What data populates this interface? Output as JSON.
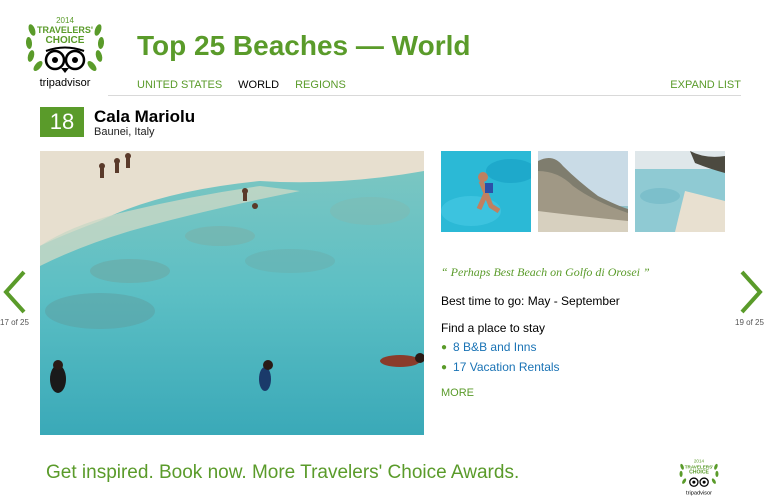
{
  "logo": {
    "year": "2014",
    "line1": "TRAVELERS'",
    "line2": "CHOICE",
    "brand": "tripadvisor"
  },
  "header": {
    "title": "Top 25 Beaches — World",
    "nav": [
      {
        "label": "UNITED STATES",
        "active": false
      },
      {
        "label": "WORLD",
        "active": true
      },
      {
        "label": "REGIONS",
        "active": false
      }
    ],
    "expand_label": "EXPAND LIST"
  },
  "beach": {
    "rank": "18",
    "name": "Cala Mariolu",
    "location": "Baunei, Italy",
    "quote": "“ Perhaps Best Beach on Golfo di Orosei ”",
    "best_time": "Best time to go: May - September",
    "find_label": "Find a place to stay",
    "stays": [
      {
        "label": "8 B&B and Inns"
      },
      {
        "label": "17 Vacation Rentals"
      }
    ],
    "more_label": "MORE"
  },
  "pager": {
    "prev_label": "17 of 25",
    "next_label": "19 of 25"
  },
  "footer": {
    "text": "Get inspired. Book now. More Travelers' Choice Awards."
  },
  "colors": {
    "accent": "#5a9b2a",
    "link": "#1a73b5"
  }
}
